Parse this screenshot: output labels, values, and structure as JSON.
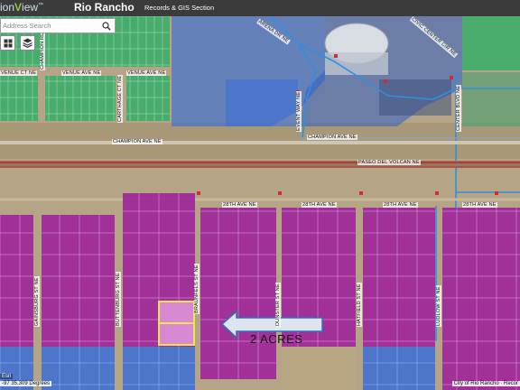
{
  "header": {
    "logo_prefix": "ion",
    "logo_v": "V",
    "logo_suffix": "iew",
    "logo_tm": "™",
    "city": "Rio Rancho",
    "section": "Records & GIS Section"
  },
  "search": {
    "placeholder": "Address Search"
  },
  "toolbar": {
    "grid_icon": "grid-icon",
    "layers_icon": "layers-icon"
  },
  "streets": {
    "avenue_ct": "VENUE CT NE",
    "venue_ave_1": "VENUE AVE NE",
    "venue_ave_2": "VENUE AVE NE",
    "champion_top": "CHAMPION RD NE",
    "carthage": "CARTHAGE CT NE",
    "arena": "ARENA DR NE",
    "civic_center": "CIVIC CENTER CIR NE",
    "center_blvd": "CENTER BLVD NE",
    "event_way": "EVENT WAY NE",
    "champion_ave_1": "CHAMPION AVE NE",
    "champion_ave_2": "CHAMPION AVE NE",
    "paseo": "PASEO DEL VOLCAN NE",
    "ave28_1": "28TH AVE NE",
    "ave28_2": "28TH AVE NE",
    "ave28_3": "28TH AVE NE",
    "ave28_4": "28TH AVE NE",
    "gainsburg": "GAINSBURG ST NE",
    "buttenburg": "BUTTENBURG ST NE",
    "braunfels": "BRAUNFELS ST NE",
    "dunster": "DUNSTER ST NE",
    "hatfield": "HATFIELD ST NE",
    "ludlow": "LUDLOW ST NE"
  },
  "callout": {
    "text": "2 ACRES"
  },
  "footer": {
    "scale": "Esri",
    "coords": "-97 35.309 Degrees",
    "attribution": "City of Rio Rancho · Recor"
  },
  "colors": {
    "topbar": "#3b3b3b",
    "green_parcels": "#3fae6a",
    "blue_parcels": "#3b6fd6",
    "magenta_parcels": "#a0279a",
    "selected_parcel": "#f1e34a",
    "road_red": "#c8322a",
    "water_line": "#2f8fe0"
  }
}
